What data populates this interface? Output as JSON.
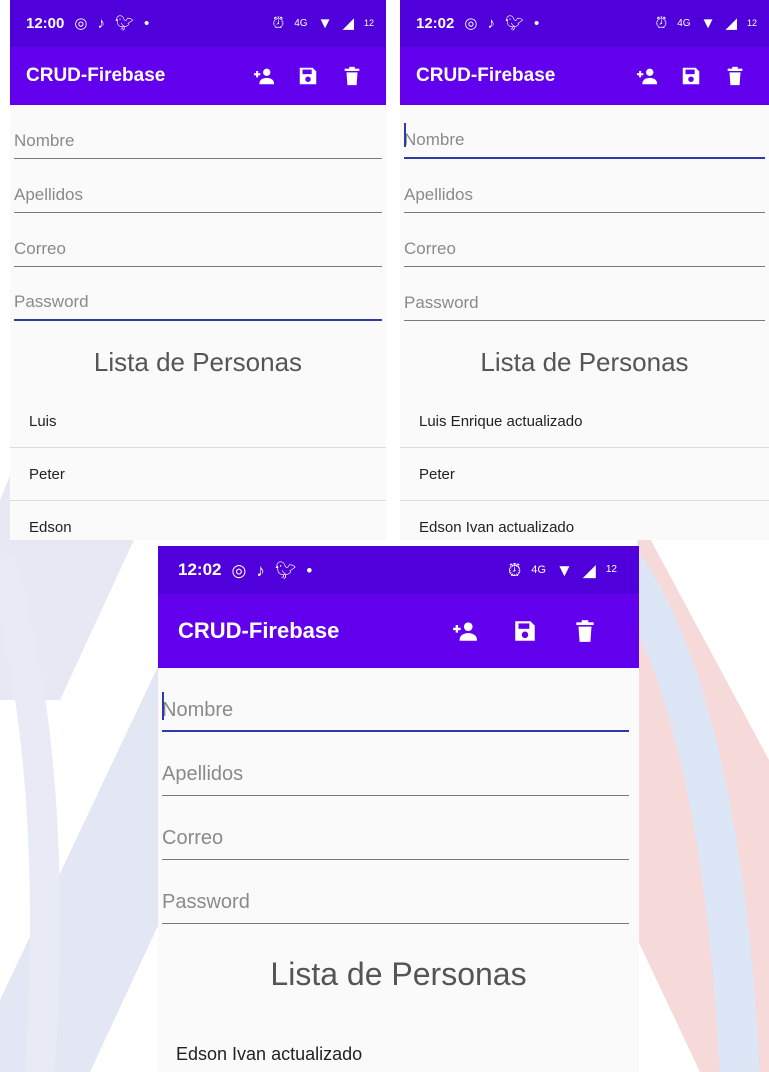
{
  "screens": [
    {
      "status_time": "12:00",
      "app_title": "CRUD-Firebase",
      "fields": {
        "nombre": "Nombre",
        "apellidos": "Apellidos",
        "correo": "Correo",
        "password": "Password"
      },
      "focused_field": "password",
      "list_title": "Lista de Personas",
      "items": [
        "Luis",
        "Peter",
        "Edson"
      ]
    },
    {
      "status_time": "12:02",
      "app_title": "CRUD-Firebase",
      "fields": {
        "nombre": "Nombre",
        "apellidos": "Apellidos",
        "correo": "Correo",
        "password": "Password"
      },
      "focused_field": "nombre",
      "list_title": "Lista de Personas",
      "items": [
        "Luis Enrique actualizado",
        "Peter",
        "Edson Ivan actualizado"
      ]
    },
    {
      "status_time": "12:02",
      "app_title": "CRUD-Firebase",
      "fields": {
        "nombre": "Nombre",
        "apellidos": "Apellidos",
        "correo": "Correo",
        "password": "Password"
      },
      "focused_field": "nombre",
      "list_title": "Lista de Personas",
      "items": [
        "Edson Ivan actualizado"
      ]
    }
  ],
  "status_icons": {
    "left": [
      "whatsapp-icon",
      "tiktok-icon",
      "twitter-icon",
      "dot-icon"
    ],
    "right": [
      "alarm-icon",
      "volte-icon",
      "wifi-icon",
      "signal-icon",
      "battery-icon"
    ],
    "network_label": "4G",
    "battery_label": "12"
  },
  "toolbar_icons": [
    "add-person-icon",
    "save-icon",
    "delete-icon"
  ],
  "colors": {
    "app_bar": "#6200ee",
    "status_bar": "#5000db",
    "focus_line": "#2f3aa8",
    "background": "#fafafa"
  }
}
